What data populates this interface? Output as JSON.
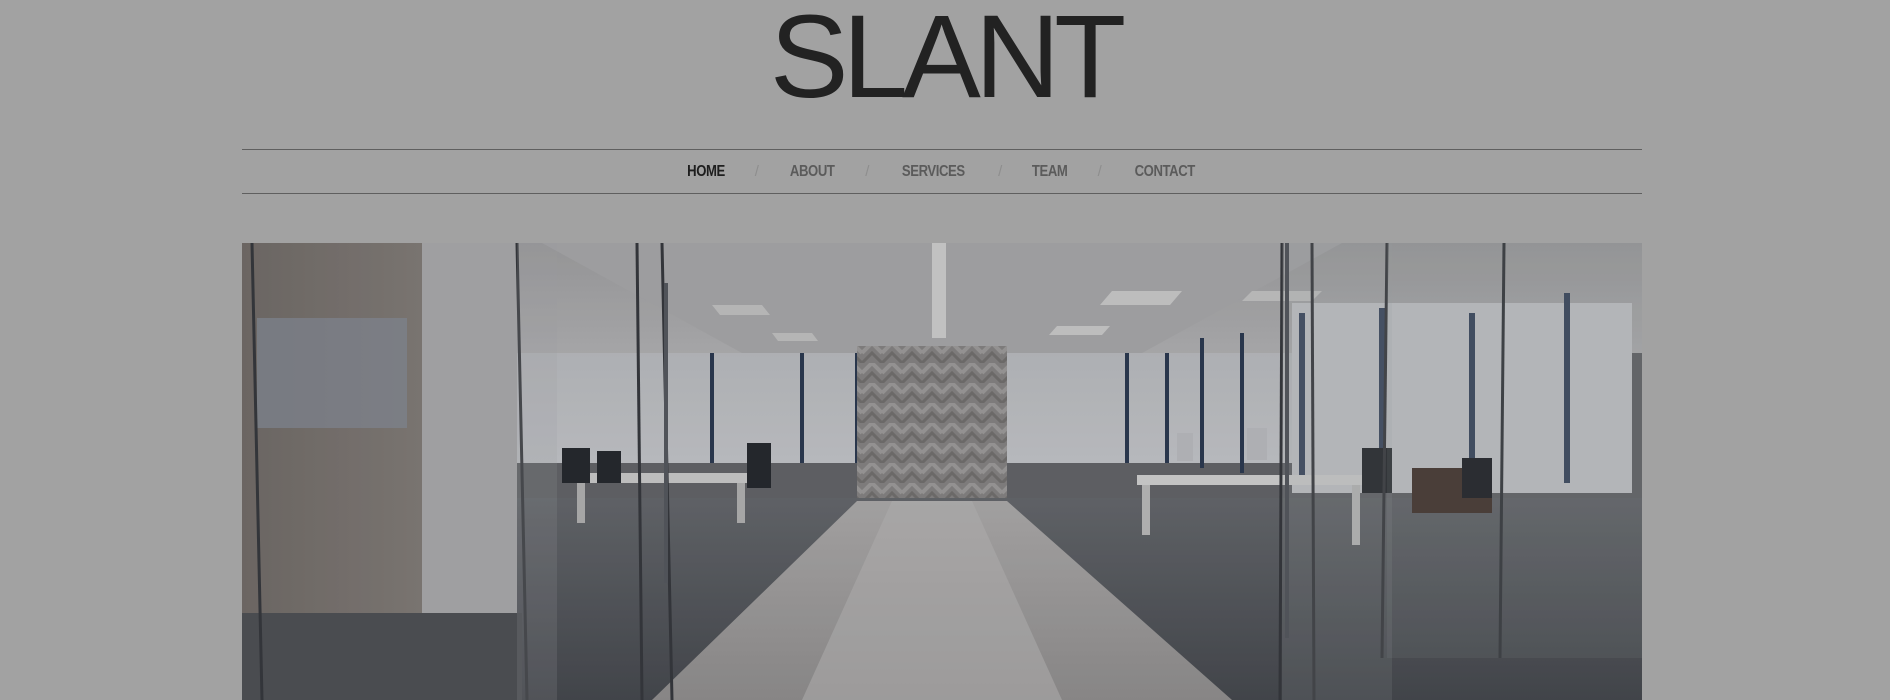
{
  "site": {
    "logo": "SLANT"
  },
  "nav": {
    "items": [
      {
        "label": "HOME",
        "active": true
      },
      {
        "label": "ABOUT",
        "active": false
      },
      {
        "label": "SERVICES",
        "active": false
      },
      {
        "label": "TEAM",
        "active": false
      },
      {
        "label": "CONTACT",
        "active": false
      }
    ],
    "separator": "/"
  },
  "hero": {
    "image": "office-interior-photo"
  },
  "colors": {
    "background": "#a2a2a2",
    "logo": "#222222",
    "nav_active": "#1e1e1e",
    "nav_inactive": "#5b5b5b",
    "rule": "#5f5f5f"
  }
}
